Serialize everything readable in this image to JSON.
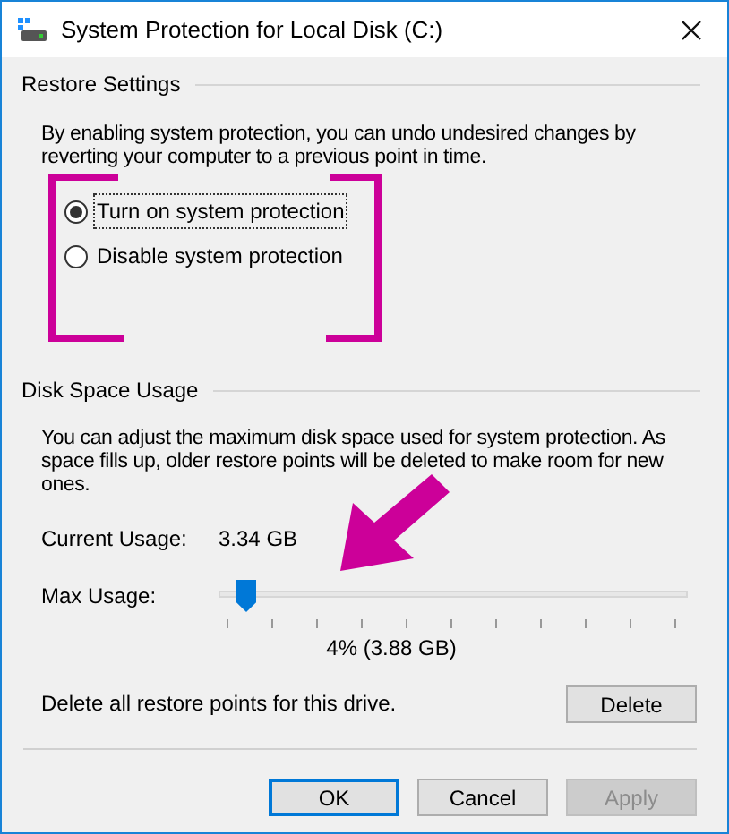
{
  "window": {
    "title": "System Protection for Local Disk (C:)"
  },
  "restore_settings": {
    "heading": "Restore Settings",
    "description": "By enabling system protection, you can undo undesired changes by reverting your computer to a previous point in time.",
    "options": [
      {
        "label": "Turn on system protection",
        "selected": true
      },
      {
        "label": "Disable system protection",
        "selected": false
      }
    ]
  },
  "disk_space_usage": {
    "heading": "Disk Space Usage",
    "description": "You can adjust the maximum disk space used for system protection. As space fills up, older restore points will be deleted to make room for new ones.",
    "current_usage_label": "Current Usage:",
    "current_usage_value": "3.34 GB",
    "max_usage_label": "Max Usage:",
    "max_usage": {
      "level": 0.04
    },
    "max_usage_reading": "4% (3.88 GB)",
    "delete_text": "Delete all restore points for this drive.",
    "delete_button": "Delete"
  },
  "buttons": [
    {
      "label": "OK",
      "kind": "default",
      "disabled": false
    },
    {
      "label": "Cancel",
      "kind": "normal",
      "disabled": false
    },
    {
      "label": "Apply",
      "kind": "normal",
      "disabled": true
    }
  ]
}
